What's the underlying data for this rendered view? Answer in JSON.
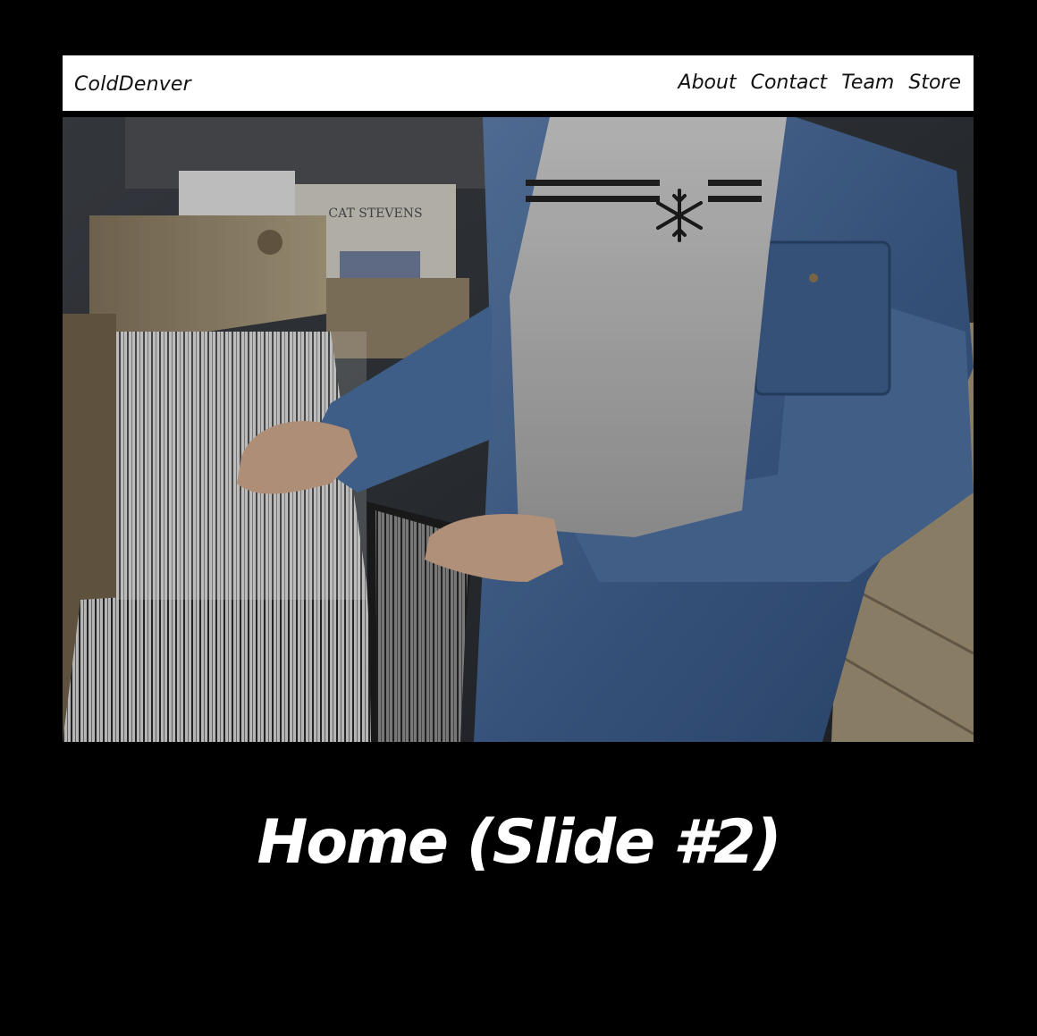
{
  "brand": {
    "name": "ColdDenver"
  },
  "nav": {
    "items": [
      {
        "label": "About"
      },
      {
        "label": "Contact"
      },
      {
        "label": "Team"
      },
      {
        "label": "Store"
      }
    ]
  },
  "hero": {
    "record_sign": "CAT STEVENS",
    "icon": "snowflake-icon"
  },
  "caption": {
    "title": "Home (Slide #2)"
  },
  "colors": {
    "background": "#000000",
    "navbar": "#ffffff",
    "denim": "#4a6a96",
    "tshirt": "#b8b8b8",
    "wood": "#9a8a6e"
  }
}
